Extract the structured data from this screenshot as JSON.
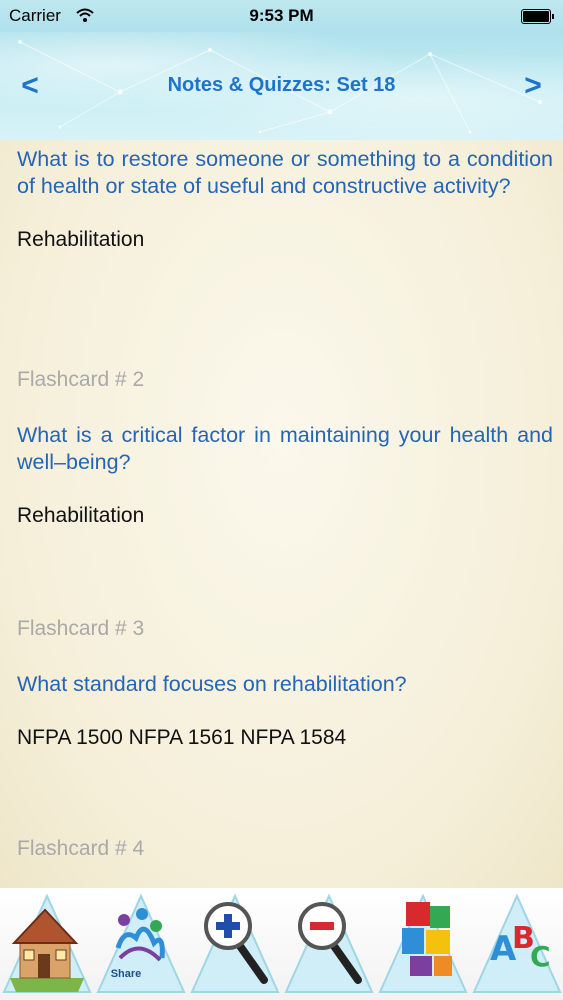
{
  "status_bar": {
    "carrier": "Carrier",
    "time": "9:53 PM"
  },
  "header": {
    "title": "Notes & Quizzes: Set 18",
    "prev": "<",
    "next": ">"
  },
  "cards": [
    {
      "label": "",
      "question": "What is to restore someone or something to a condition of health or state of useful and constructive activity?",
      "answer": "Rehabilitation"
    },
    {
      "label": "Flashcard # 2",
      "question": "What is a critical factor in maintaining your health and well–being?",
      "answer": "Rehabilitation"
    },
    {
      "label": "Flashcard # 3",
      "question": "What standard focuses on rehabilitation?",
      "answer": "NFPA 1500 NFPA 1561 NFPA 1584"
    },
    {
      "label": "Flashcard # 4",
      "question": "",
      "answer": ""
    }
  ],
  "toolbar": {
    "home": {
      "icon": "house-icon",
      "label": ""
    },
    "share": {
      "icon": "share-icon",
      "label": "Share"
    },
    "zoom_in": {
      "icon": "zoom-in-icon",
      "label": ""
    },
    "zoom_out": {
      "icon": "zoom-out-icon",
      "label": ""
    },
    "puzzle": {
      "icon": "puzzle-icon",
      "label": ""
    },
    "abc": {
      "icon": "abc-icon",
      "label": ""
    }
  },
  "colors": {
    "accent": "#1f73c8",
    "question": "#2565b5",
    "label": "#a9a9a9",
    "background": "#f7f2e1"
  }
}
